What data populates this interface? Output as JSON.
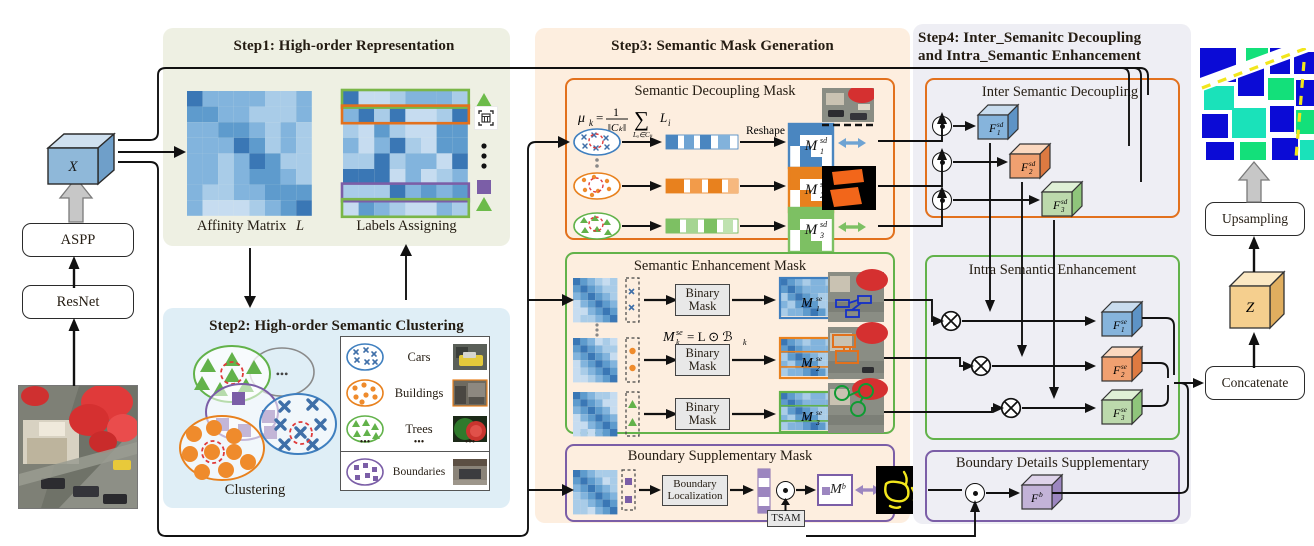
{
  "figure": {
    "type": "architecture-diagram",
    "domain": "semantic segmentation network pipeline"
  },
  "backbone": {
    "resnet_label": "ResNet",
    "aspp_label": "ASPP",
    "feature_cube_label": "X",
    "input_image_name": "aerial-rgb-input"
  },
  "step1": {
    "title": "Step1: High-order Representation",
    "affinity_caption": "Affinity Matrix",
    "affinity_symbol": "L",
    "labels_caption": "Labels Assigning",
    "bg_color": "#eef0e3",
    "row_highlights": [
      {
        "index": 0,
        "color": "#7ab648",
        "marker": "triangle",
        "marker_color": "#6cbb4a"
      },
      {
        "index": 1,
        "color": "#e2711d",
        "marker": "square",
        "marker_color": "#e2711d"
      },
      {
        "index": 6,
        "color": "#7b5ea7",
        "marker": "square",
        "marker_color": "#7b5ea7"
      },
      {
        "index": 7,
        "color": "#7ab648",
        "marker": "triangle",
        "marker_color": "#6cbb4a"
      }
    ],
    "ellipsis_marker": "⋮"
  },
  "step2": {
    "title": "Step2: High-order Semantic Clustering",
    "caption": "Clustering",
    "bg_color": "#dfeef6",
    "legend": [
      {
        "label": "Cars",
        "color": "#3f7fbf",
        "glyph": "✕"
      },
      {
        "label": "Buildings",
        "color": "#e8811e",
        "glyph": "●"
      },
      {
        "label": "Trees",
        "color": "#62b24a",
        "glyph": "▲"
      },
      {
        "label": "Boundaries",
        "color": "#7b5ea7",
        "glyph": "■"
      }
    ],
    "legend_ellipsis": "•••",
    "cluster_ellipsis": "•••"
  },
  "step3": {
    "title": "Step3: Semantic Mask Generation",
    "bg_color": "#fdeedf",
    "decoupling": {
      "title": "Semantic Decoupling Mask",
      "border_color": "#e2711d",
      "formula_mu": "μ",
      "formula_sub_k": "k",
      "formula_eq": "=",
      "formula_num": "1",
      "formula_den": "‖C",
      "formula_den_sub": "k",
      "formula_den_end": "‖",
      "formula_sigma": "∑",
      "formula_sigma_sub": "Lᵢ∈Cₖ",
      "formula_term": "L",
      "formula_term_sub": "i",
      "reshape_label": "Reshape",
      "masks": [
        {
          "label": "M",
          "sup": "sd",
          "sub": "1",
          "color": "#3f7fbf"
        },
        {
          "label": "M",
          "sup": "sd",
          "sub": "2",
          "color": "#e8811e"
        },
        {
          "label": "M",
          "sup": "sd",
          "sub": "3",
          "color": "#62b24a"
        }
      ]
    },
    "enhancement": {
      "title": "Semantic Enhancement Mask",
      "border_color": "#62b24a",
      "formula": "M",
      "formula_sup": "se",
      "formula_sub": "k",
      "formula_eq": "= L ⊙ ℬ",
      "formula_eq_sub": "k",
      "binary_mask_label_line1": "Binary",
      "binary_mask_label_line2": "Mask",
      "masks": [
        {
          "label": "M",
          "sup": "se",
          "sub": "1",
          "color": "#3f7fbf"
        },
        {
          "label": "M",
          "sup": "se",
          "sub": "2",
          "color": "#e8811e"
        },
        {
          "label": "M",
          "sup": "se",
          "sub": "3",
          "color": "#62b24a"
        }
      ]
    },
    "boundary": {
      "title": "Boundary Supplementary Mask",
      "border_color": "#7b5ea7",
      "localization_label_line1": "Boundary",
      "localization_label_line2": "Localization",
      "tsam_label": "TSAM",
      "mask_label": "M",
      "mask_sup": "b",
      "color": "#7b5ea7"
    }
  },
  "step4": {
    "title_line1": "Step4: Inter_Semanitc Decoupling",
    "title_line2": "and Intra_Semantic Enhancement",
    "bg_color": "#eeeef4",
    "inter": {
      "title": "Inter Semantic Decoupling",
      "border_color": "#e2711d",
      "op_symbol": "⊙",
      "cubes": [
        {
          "label": "F",
          "sup": "sd",
          "sub": "1",
          "color": "#86b4dc"
        },
        {
          "label": "F",
          "sup": "sd",
          "sub": "2",
          "color": "#f0a070"
        },
        {
          "label": "F",
          "sup": "sd",
          "sub": "3",
          "color": "#bcd9ac"
        }
      ]
    },
    "intra": {
      "title": "Intra Semantic Enhancement",
      "border_color": "#62b24a",
      "op_symbol": "⊗",
      "cubes": [
        {
          "label": "F",
          "sup": "se",
          "sub": "1",
          "color": "#86b4dc"
        },
        {
          "label": "F",
          "sup": "se",
          "sub": "2",
          "color": "#f0a070"
        },
        {
          "label": "F",
          "sup": "se",
          "sub": "3",
          "color": "#bcd9ac"
        }
      ]
    },
    "boundary_details": {
      "title": "Boundary Details Supplementary",
      "border_color": "#7b5ea7",
      "op_symbol": "⊙",
      "cube": {
        "label": "F",
        "sup": "b",
        "color": "#c3b3d8"
      }
    }
  },
  "output": {
    "concatenate_label": "Concatenate",
    "z_cube_label": "Z",
    "z_cube_color": "#f5cf8e",
    "upsampling_label": "Upsampling",
    "prediction_name": "segmentation-prediction-map"
  }
}
